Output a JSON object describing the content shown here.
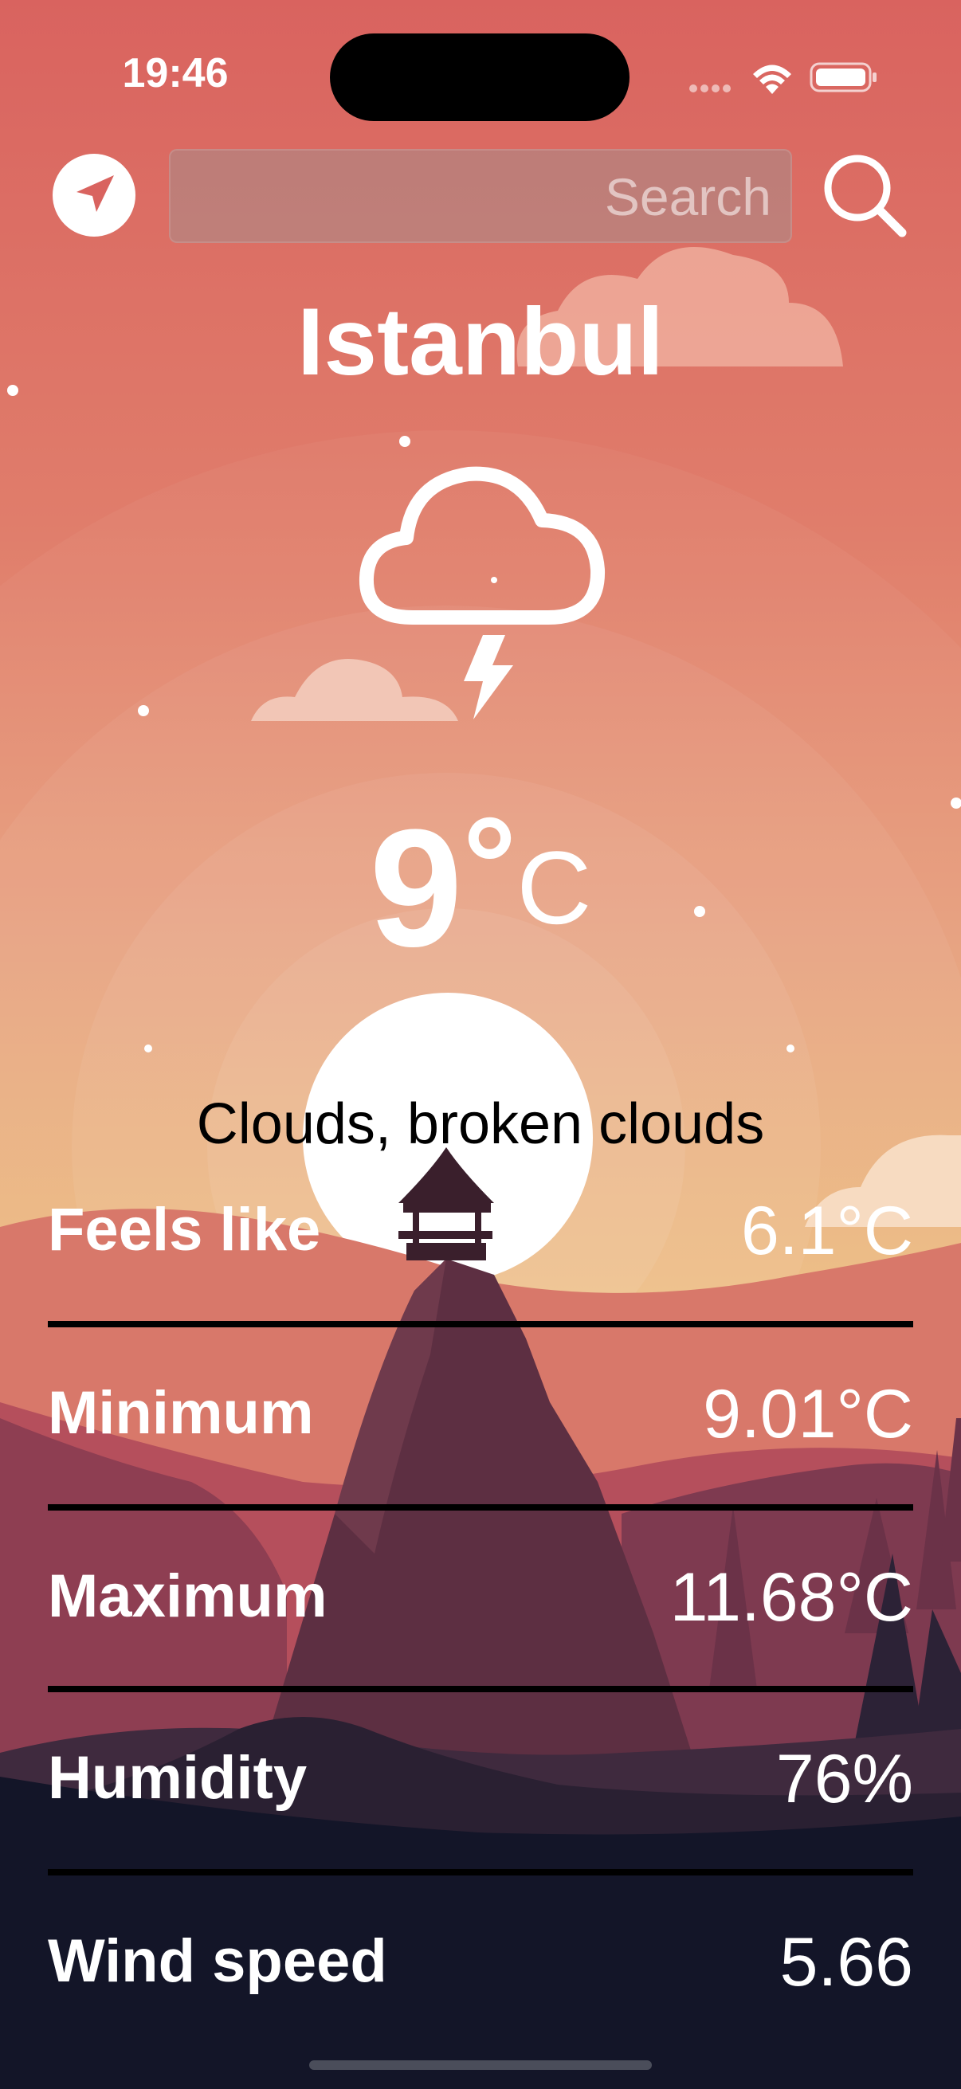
{
  "status_bar": {
    "time": "19:46"
  },
  "search": {
    "placeholder": "Search"
  },
  "weather": {
    "city": "Istanbul",
    "temperature": "9",
    "degree_symbol": "°",
    "unit": "C",
    "description": "Clouds, broken clouds"
  },
  "details": [
    {
      "label": "Feels like",
      "value": "6.1°C"
    },
    {
      "label": "Minimum",
      "value": "9.01°C"
    },
    {
      "label": "Maximum",
      "value": "11.68°C"
    },
    {
      "label": "Humidity",
      "value": "76%"
    },
    {
      "label": "Wind speed",
      "value": "5.66"
    }
  ],
  "icons": {
    "location": "location-arrow-icon",
    "search": "search-icon",
    "weather": "thunder-cloud-icon"
  },
  "colors": {
    "sky_top": "#d9635f",
    "sky_mid": "#e79a78",
    "horizon": "#ecb877",
    "ground_dark": "#131528",
    "text_light": "#ffffff"
  }
}
